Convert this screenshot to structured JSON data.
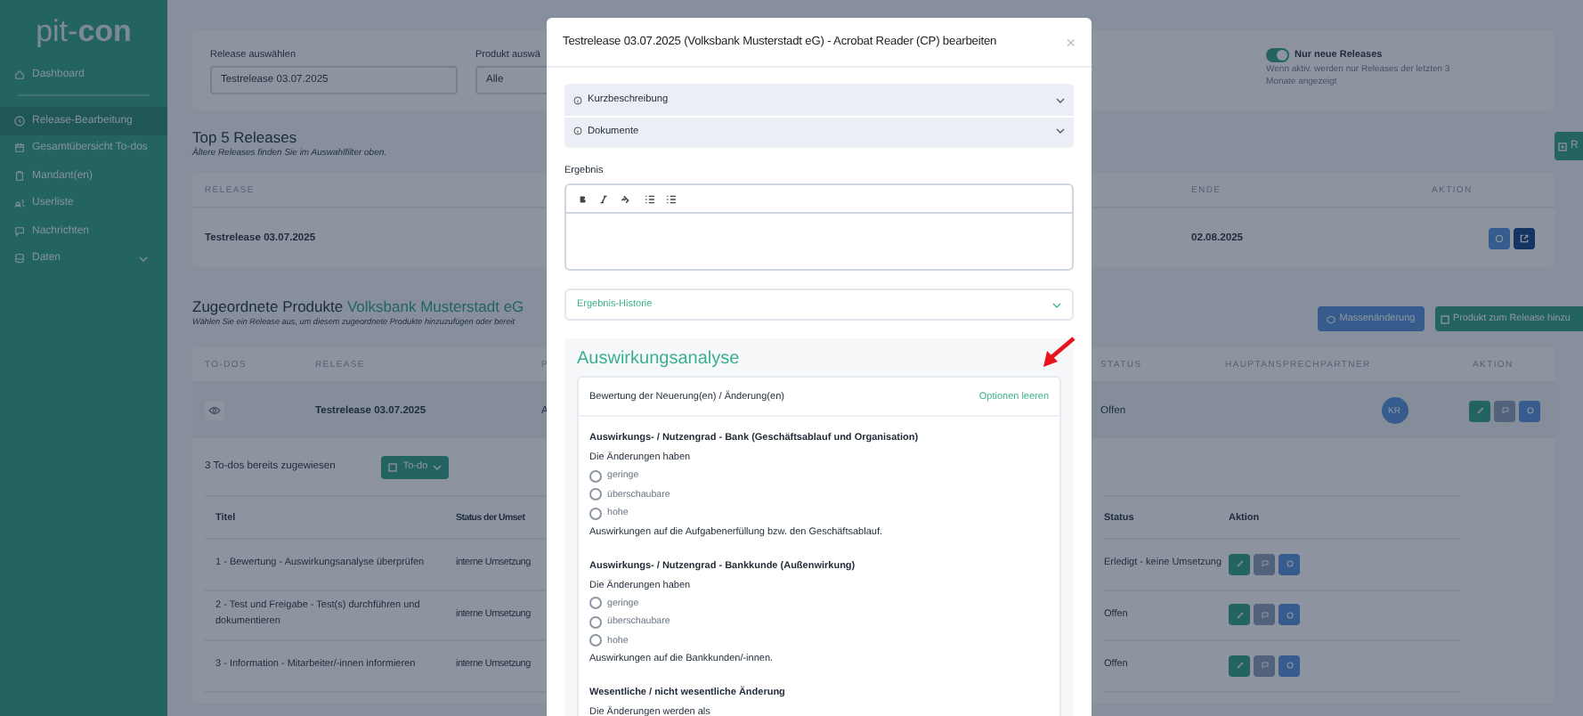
{
  "sidebar": {
    "logo": {
      "light": "pit-",
      "bold": "con"
    },
    "items": [
      {
        "label": "Dashboard",
        "selected": false,
        "has_submenu": false
      },
      {
        "label": "Release-Bearbeitung",
        "selected": true,
        "has_submenu": false
      },
      {
        "label": "Gesamtübersicht To-dos",
        "selected": false,
        "has_submenu": false
      },
      {
        "label": "Mandant(en)",
        "selected": false,
        "has_submenu": false
      },
      {
        "label": "Userliste",
        "selected": false,
        "has_submenu": false
      },
      {
        "label": "Nachrichten",
        "selected": false,
        "has_submenu": false
      },
      {
        "label": "Daten",
        "selected": false,
        "has_submenu": true
      }
    ]
  },
  "filter": {
    "release_label": "Release auswählen",
    "release_value": "Testrelease 03.07.2025",
    "product_label": "Produkt auswä",
    "product_value": "Alle",
    "toggle": {
      "label": "Nur neue Releases",
      "on": true,
      "hint": "Wenn aktiv, werden nur Releases der letzten 3 Monate angezeigt"
    }
  },
  "top_releases": {
    "title": "Top 5 Releases",
    "subtitle": "Ältere Releases finden Sie im Auswahlfilter oben.",
    "button": "R",
    "columns": [
      "RELEASE",
      "ENDE",
      "AKTION"
    ],
    "rows": [
      {
        "release": "Testrelease 03.07.2025",
        "end": "02.08.2025"
      }
    ]
  },
  "products": {
    "title": "Zugeordnete Produkte",
    "bank": "Volksbank Musterstadt eG",
    "subtitle": "Wählen Sie ein Release aus, um diesem zugeordnete Produkte hinzuzufügen oder bereit",
    "buttons": [
      "Massenänderung",
      "Produkt zum Release hinzu"
    ],
    "columns": [
      "TO-DOS",
      "RELEASE",
      "P",
      "STATUS",
      "HAUPTANSPRECHPARTNER",
      "AKTION"
    ],
    "rows": [
      {
        "release": "Testrelease 03.07.2025",
        "column_3": "A",
        "status": "Offen",
        "contact": "KR"
      }
    ],
    "todos": {
      "count": "3 To-dos bereits zugewiesen",
      "button": "To-do",
      "columns": [
        "Titel",
        "Status der Umset",
        "Status",
        "Aktion"
      ],
      "rows": [
        {
          "title": "1 - Bewertung - Auswirkungsanalyse überprüfen",
          "implementation": "interne Umsetzung",
          "status": "Erledigt - keine Umsetzung"
        },
        {
          "title": "2 - Test und Freigabe - Test(s) durchführen und dokumentieren",
          "implementation": "interne Umsetzung",
          "status": "Offen"
        },
        {
          "title": "3 - Information - Mitarbeiter/-innen informieren",
          "implementation": "interne Umsetzung",
          "status": "Offen"
        }
      ]
    }
  },
  "modal": {
    "title": "Testrelease 03.07.2025 (Volksbank Musterstadt eG) - Acrobat Reader (CP) bearbeiten",
    "close": "×",
    "sections": [
      {
        "label": "Kurzbeschreibung",
        "expanded": false
      },
      {
        "label": "Dokumente",
        "expanded": false
      }
    ],
    "result_label": "Ergebnis",
    "history": {
      "label": "Ergebnis-Historie",
      "expanded": false
    },
    "analysis": {
      "title": "Auswirkungsanalyse",
      "card_title": "Bewertung der Neuerung(en) / Änderung(en)",
      "clear_link": "Optionen leeren",
      "groups": [
        {
          "title": "Auswirkungs- / Nutzengrad - Bank (Geschäftsablauf und Organisation)",
          "question": "Die Änderungen haben",
          "options": [
            {
              "label": "geringe",
              "selected": false
            },
            {
              "label": "überschaubare",
              "selected": false
            },
            {
              "label": "hohe",
              "selected": false
            }
          ],
          "note": "Auswirkungen auf die Aufgabenerfüllung bzw. den Geschäftsablauf."
        },
        {
          "title": "Auswirkungs- / Nutzengrad - Bankkunde (Außenwirkung)",
          "question": "Die Änderungen haben",
          "options": [
            {
              "label": "geringe",
              "selected": false
            },
            {
              "label": "überschaubare",
              "selected": false
            },
            {
              "label": "hohe",
              "selected": false
            }
          ],
          "note": "Auswirkungen auf die Bankkunden/-innen."
        },
        {
          "title": "Wesentliche / nicht wesentliche Änderung",
          "question": "Die Änderungen werden als"
        }
      ]
    }
  }
}
